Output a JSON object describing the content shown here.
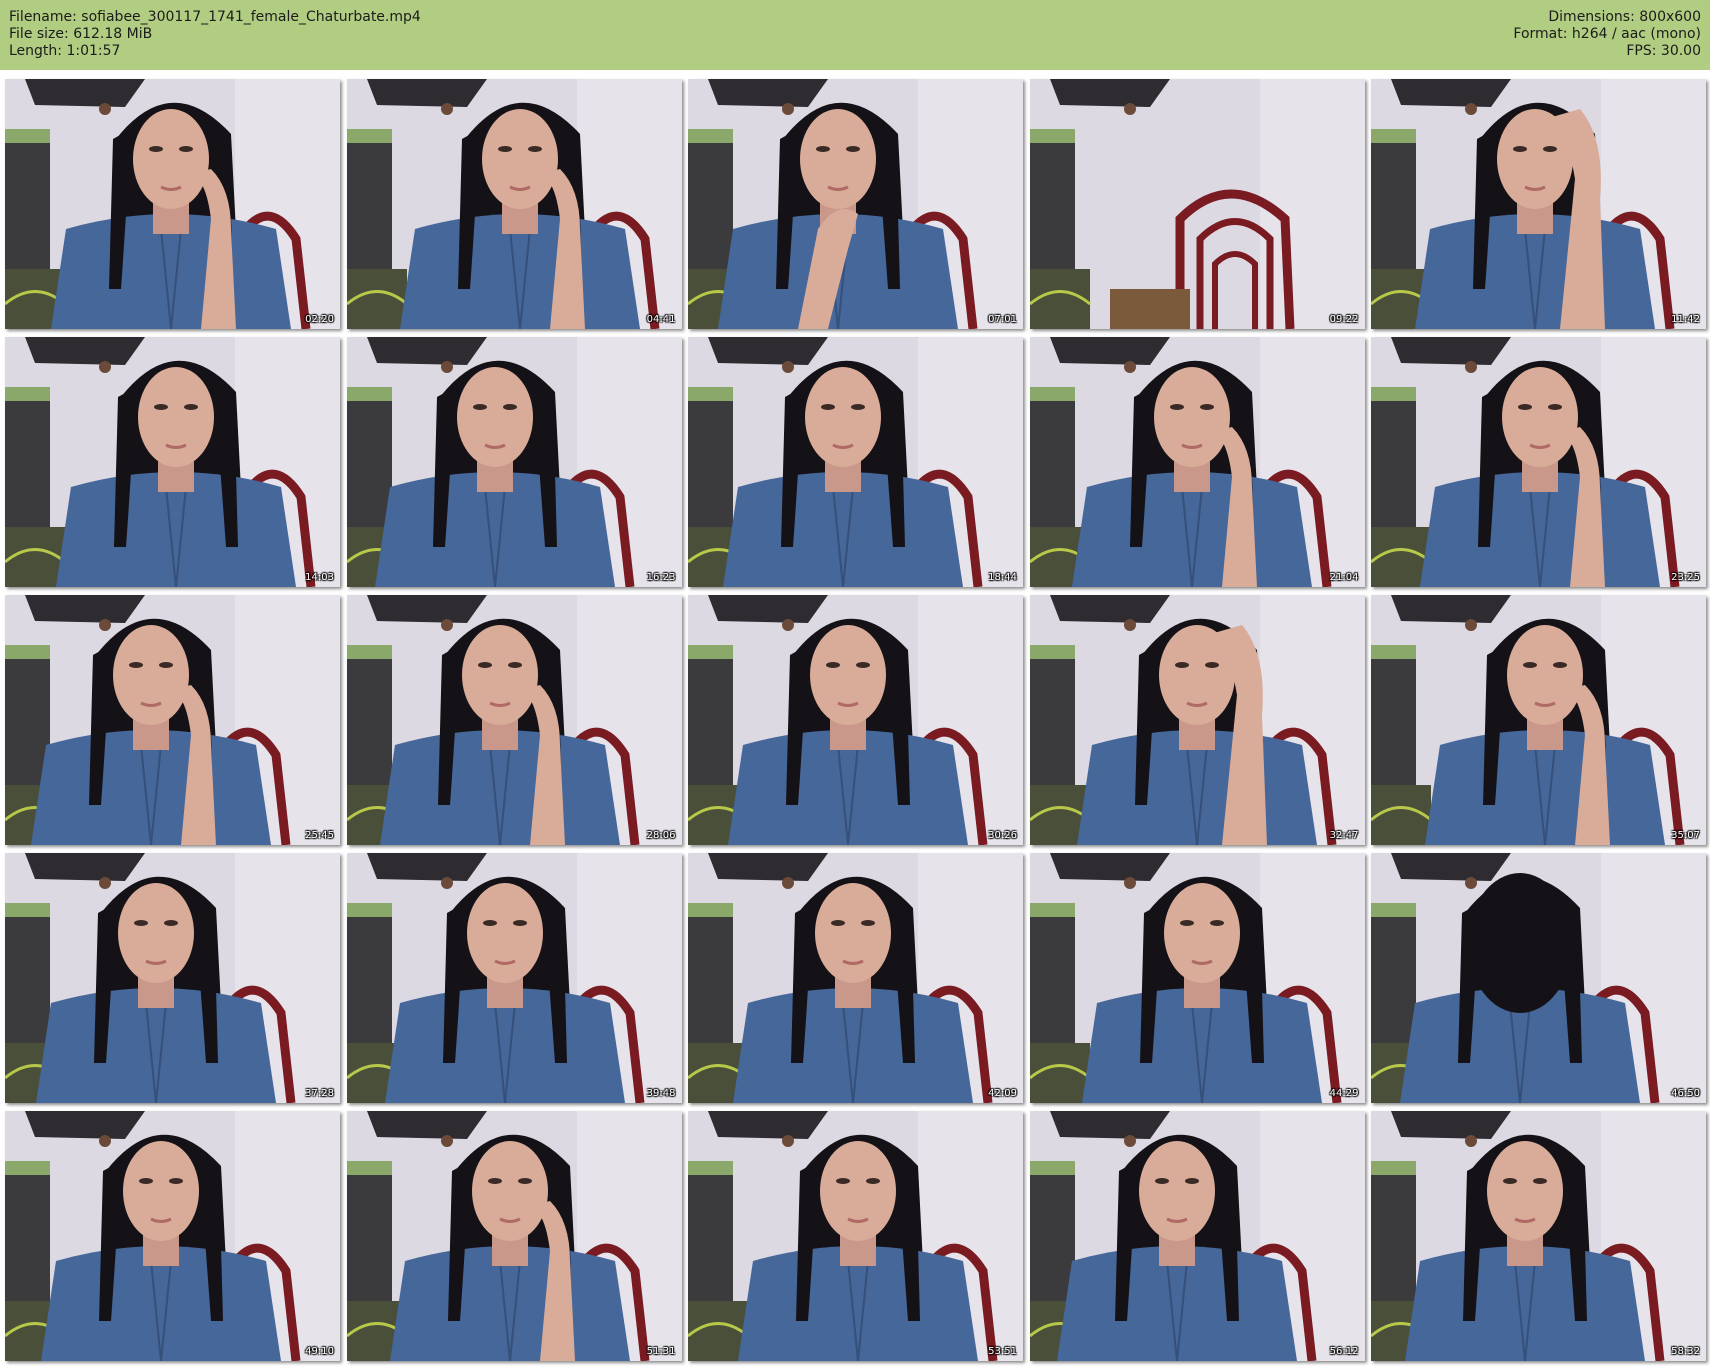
{
  "header": {
    "filename": "Filename: sofiabee_300117_1741_female_Chaturbate.mp4",
    "filesize": "File size: 612.18 MiB",
    "length": "Length: 1:01:57",
    "dimensions": "Dimensions: 800x600",
    "format": "Format: h264 / aac (mono)",
    "fps": "FPS: 30.00"
  },
  "colors": {
    "header_bg": "#b1cd81",
    "wall": "#dcd9e2",
    "cabinet": "#3b3b3d",
    "cabinet_top": "#8aa869",
    "hair": "#141216",
    "skin": "#d9ab99",
    "shirt": "#46679a",
    "chair": "#7a1b22"
  },
  "thumbnails": [
    {
      "time": "02:20",
      "pose": "hand-cheek"
    },
    {
      "time": "04:41",
      "pose": "lean-hand"
    },
    {
      "time": "07:01",
      "pose": "hand-chin"
    },
    {
      "time": "09:22",
      "pose": "empty-chair"
    },
    {
      "time": "11:42",
      "pose": "hand-hair"
    },
    {
      "time": "14:03",
      "pose": "neutral"
    },
    {
      "time": "16:23",
      "pose": "neutral"
    },
    {
      "time": "18:44",
      "pose": "neutral"
    },
    {
      "time": "21:04",
      "pose": "lean-hand"
    },
    {
      "time": "23:25",
      "pose": "lean-hand"
    },
    {
      "time": "25:45",
      "pose": "hand-cheek"
    },
    {
      "time": "28:06",
      "pose": "lean-hand"
    },
    {
      "time": "30:26",
      "pose": "neutral"
    },
    {
      "time": "32:47",
      "pose": "hand-hair"
    },
    {
      "time": "35:07",
      "pose": "hand-cheek"
    },
    {
      "time": "37:28",
      "pose": "neutral"
    },
    {
      "time": "39:48",
      "pose": "neutral"
    },
    {
      "time": "42:09",
      "pose": "neutral"
    },
    {
      "time": "44:29",
      "pose": "neutral"
    },
    {
      "time": "46:50",
      "pose": "hair-over"
    },
    {
      "time": "49:10",
      "pose": "neutral"
    },
    {
      "time": "51:31",
      "pose": "lean-hand"
    },
    {
      "time": "53:51",
      "pose": "neutral"
    },
    {
      "time": "56:12",
      "pose": "neutral"
    },
    {
      "time": "58:32",
      "pose": "neutral"
    }
  ]
}
